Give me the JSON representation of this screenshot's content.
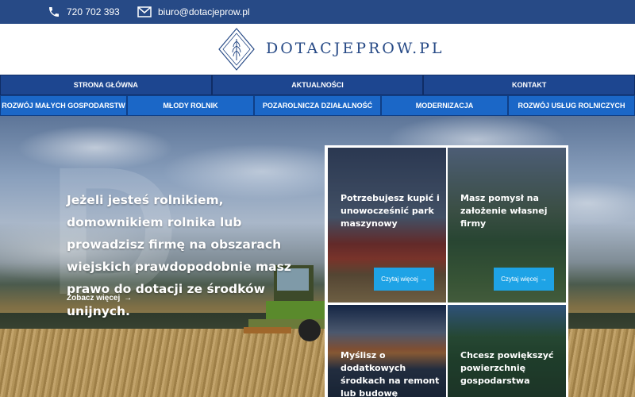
{
  "contact": {
    "phone": "720 702 393",
    "email": "biuro@dotacjeprow.pl",
    "phone_icon": "phone-icon",
    "email_icon": "envelope-icon"
  },
  "brand": {
    "name": "DOTACJEPROW.PL",
    "logo_icon": "wheat-diamond-logo"
  },
  "nav_primary": [
    {
      "label": "STRONA GŁÓWNA"
    },
    {
      "label": "AKTUALNOŚCI"
    },
    {
      "label": "KONTAKT"
    }
  ],
  "nav_secondary": [
    {
      "label": "ROZWÓJ MAŁYCH GOSPODARSTW"
    },
    {
      "label": "MŁODY ROLNIK"
    },
    {
      "label": "POZAROLNICZA DZIAŁALNOŚĆ"
    },
    {
      "label": "MODERNIZACJA"
    },
    {
      "label": "ROZWÓJ USŁUG ROLNICZYCH"
    }
  ],
  "hero": {
    "text": "Jeżeli jesteś rolnikiem, domownikiem rolnika lub prowadzisz firmę na obszarach wiejskich prawdopodobnie masz prawo do dotacji ze środków unijnych.",
    "more_label": "Zobacz więcej",
    "more_arrow": "→"
  },
  "cards": [
    {
      "title": "Potrzebujesz kupić i unowocześnić park maszynowy",
      "button": "Czytaj więcej",
      "arrow": "→"
    },
    {
      "title": "Masz pomysł na założenie własnej firmy",
      "button": "Czytaj więcej",
      "arrow": "→"
    },
    {
      "title": "Myślisz o dodatkowych środkach na remont lub budowę",
      "button": "",
      "arrow": ""
    },
    {
      "title": "Chcesz powiększyć powierzchnię gospodarstwa",
      "button": "",
      "arrow": ""
    }
  ],
  "colors": {
    "topbar": "#274a86",
    "nav_primary": "#1d4690",
    "nav_secondary": "#1b67c7",
    "button": "#1ea3e6"
  }
}
